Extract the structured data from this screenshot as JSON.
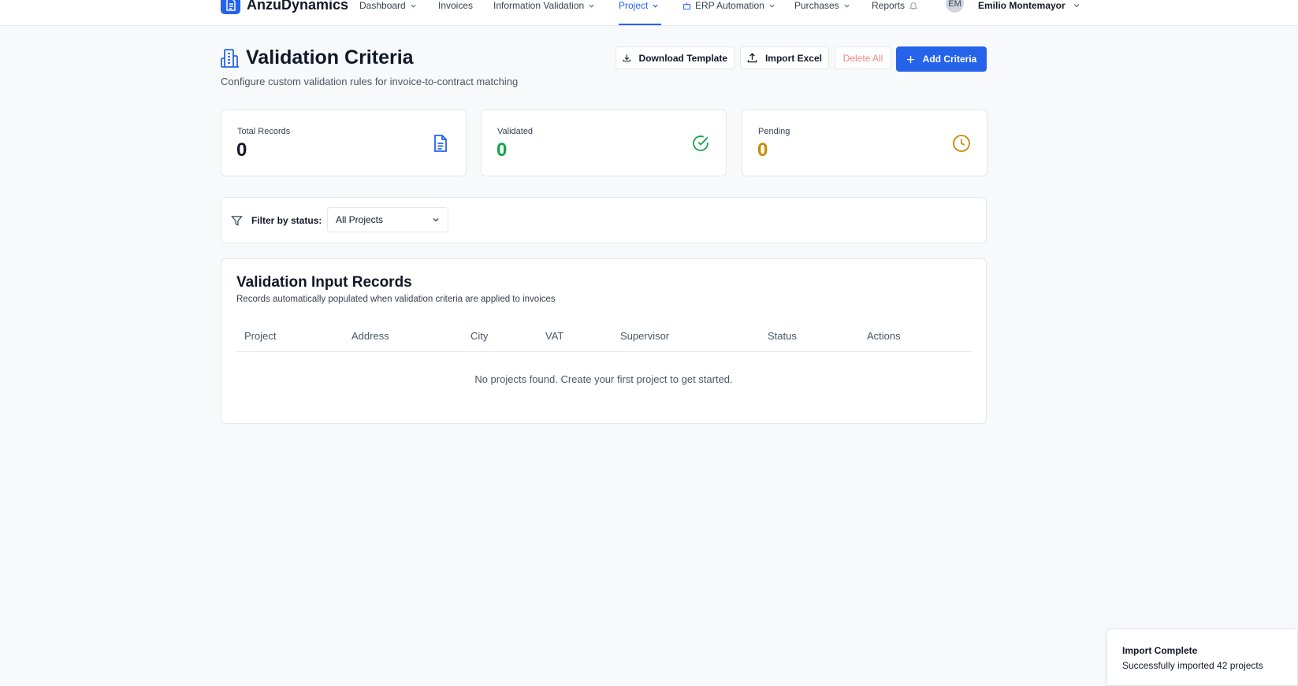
{
  "app": {
    "brand": "AnzuDynamics"
  },
  "nav": {
    "dashboard": "Dashboard",
    "invoices": "Invoices",
    "information_validation": "Information Validation",
    "project": "Project",
    "erp_automation": "ERP Automation",
    "purchases": "Purchases",
    "reports": "Reports"
  },
  "user": {
    "initials": "EM",
    "name": "Emilio Montemayor"
  },
  "page": {
    "title": "Validation Criteria",
    "subtitle": "Configure custom validation rules for invoice-to-contract matching"
  },
  "actions": {
    "download_template": "Download Template",
    "import_excel": "Import Excel",
    "delete_all": "Delete All",
    "add_criteria": "Add Criteria"
  },
  "stats": {
    "total": {
      "label": "Total Records",
      "value": "0",
      "color": "#111827"
    },
    "validated": {
      "label": "Validated",
      "value": "0",
      "color": "#16a34a"
    },
    "pending": {
      "label": "Pending",
      "value": "0",
      "color": "#ca8a04"
    }
  },
  "filter": {
    "label": "Filter by status:",
    "selected": "All Projects"
  },
  "records": {
    "title": "Validation Input Records",
    "subtitle": "Records automatically populated when validation criteria are applied to invoices",
    "columns": [
      "Project",
      "Address",
      "City",
      "VAT",
      "Supervisor",
      "Status",
      "Actions"
    ],
    "empty_message": "No projects found. Create your first project to get started."
  },
  "toast": {
    "title": "Import Complete",
    "message": "Successfully imported 42 projects"
  },
  "colors": {
    "accent": "#2563eb",
    "success": "#16a34a",
    "warning": "#ca8a04",
    "danger": "#f08585"
  }
}
